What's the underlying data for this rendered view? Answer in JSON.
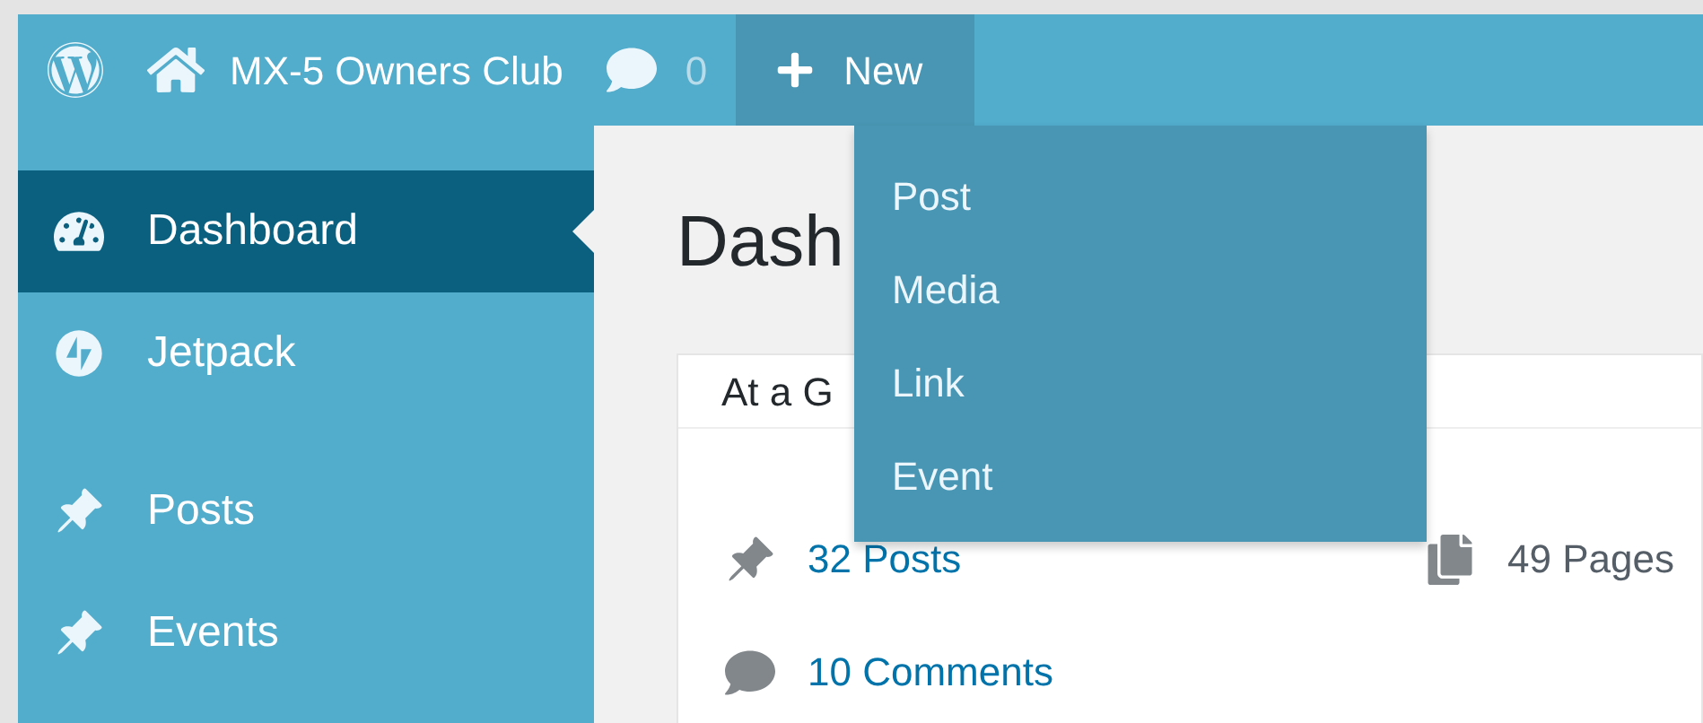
{
  "admin_bar": {
    "site_name": "MX-5 Owners Club",
    "comments_count": "0",
    "new_label": "New",
    "new_open": true
  },
  "new_menu": [
    "Post",
    "Media",
    "Link",
    "Event"
  ],
  "sidebar": {
    "items": [
      {
        "label": "Dashboard",
        "selected": true,
        "group_start": false
      },
      {
        "label": "Jetpack",
        "selected": false,
        "group_start": false
      },
      {
        "label": "Posts",
        "selected": false,
        "group_start": true
      },
      {
        "label": "Events",
        "selected": false,
        "group_start": false
      }
    ]
  },
  "page_title": "Dash",
  "card": {
    "title": "At a G",
    "stats": [
      {
        "label": "32 Posts",
        "kind": "link"
      },
      {
        "label": "49 Pages",
        "kind": "text"
      },
      {
        "label": "10 Comments",
        "kind": "link"
      }
    ]
  }
}
